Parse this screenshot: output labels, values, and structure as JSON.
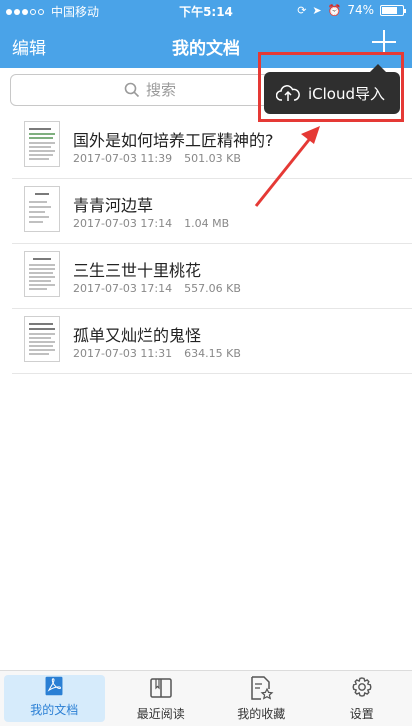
{
  "status": {
    "carrier": "中国移动",
    "time": "下午5:14",
    "battery_pct": "74%",
    "battery_level": 0.74,
    "signal_filled": 3,
    "signal_total": 5
  },
  "nav": {
    "edit_label": "编辑",
    "title": "我的文档"
  },
  "search": {
    "placeholder": "搜索"
  },
  "popup": {
    "label": "iCloud导入"
  },
  "colors": {
    "header": "#4aa3e8",
    "popup": "#2f2f2f",
    "highlight": "#e53935",
    "active_tab": "#2a7fd4"
  },
  "documents": [
    {
      "title": "国外是如何培养工匠精神的?",
      "date": "2017-07-03 11:39",
      "size": "501.03 KB"
    },
    {
      "title": "青青河边草",
      "date": "2017-07-03 17:14",
      "size": "1.04 MB"
    },
    {
      "title": "三生三世十里桃花",
      "date": "2017-07-03 17:14",
      "size": "557.06 KB"
    },
    {
      "title": "孤单又灿烂的鬼怪",
      "date": "2017-07-03 11:31",
      "size": "634.15 KB"
    }
  ],
  "tabs": [
    {
      "label": "我的文档",
      "icon": "pdf-document-icon",
      "active": true
    },
    {
      "label": "最近阅读",
      "icon": "book-icon",
      "active": false
    },
    {
      "label": "我的收藏",
      "icon": "star-document-icon",
      "active": false
    },
    {
      "label": "设置",
      "icon": "gear-icon",
      "active": false
    }
  ]
}
